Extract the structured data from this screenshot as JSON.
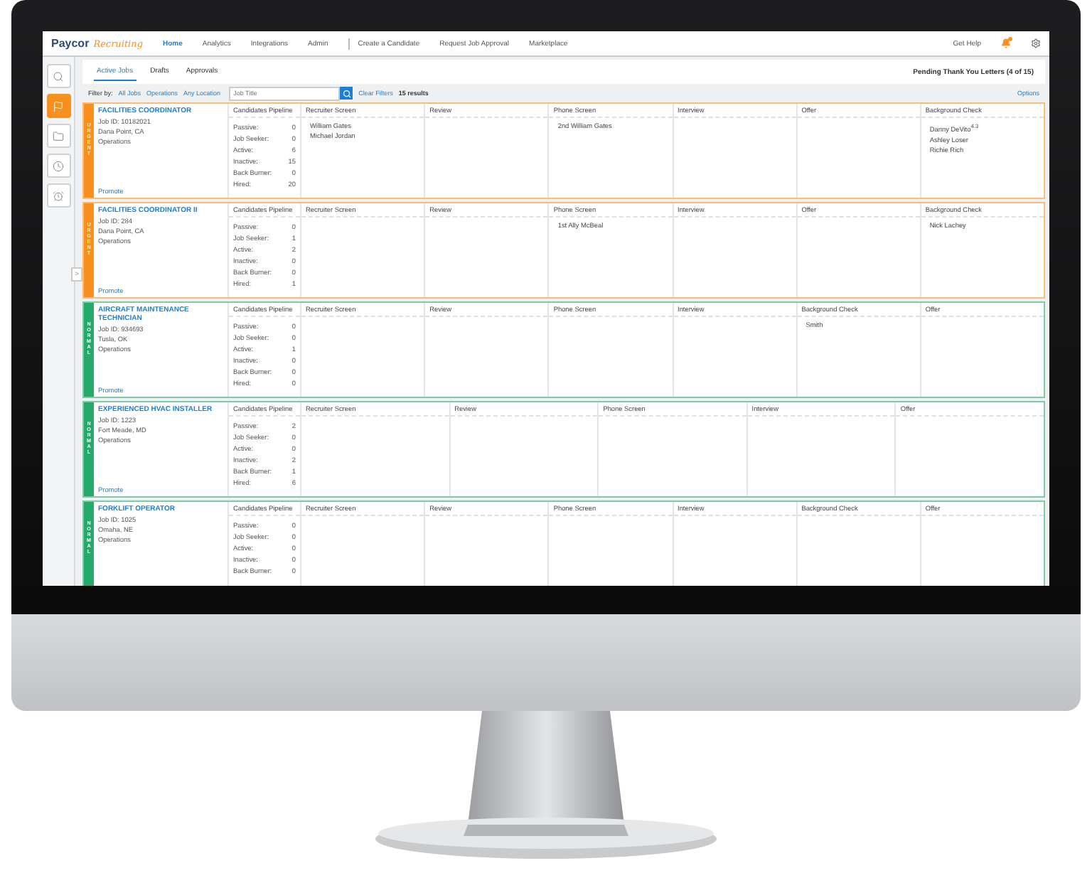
{
  "brand": {
    "name": "Paycor",
    "product": "Recruiting"
  },
  "nav": [
    {
      "label": "Home",
      "selected": true,
      "divider_before": false
    },
    {
      "label": "Analytics",
      "selected": false,
      "divider_before": false
    },
    {
      "label": "Integrations",
      "selected": false,
      "divider_before": false
    },
    {
      "label": "Admin",
      "selected": false,
      "divider_before": false
    },
    {
      "label": "Create a Candidate",
      "selected": false,
      "divider_before": true
    },
    {
      "label": "Request Job Approval",
      "selected": false,
      "divider_before": false
    },
    {
      "label": "Marketplace",
      "selected": false,
      "divider_before": false
    }
  ],
  "help": "Get Help",
  "rail": [
    {
      "selected": false
    },
    {
      "selected": true
    },
    {
      "selected": false
    },
    {
      "selected": false
    },
    {
      "selected": false
    }
  ],
  "collapse_toggle": ">",
  "tabs": [
    {
      "label": "Active Jobs",
      "selected": true
    },
    {
      "label": "Drafts",
      "selected": false
    },
    {
      "label": "Approvals",
      "selected": false
    }
  ],
  "pending": "Pending Thank You Letters (4 of 15)",
  "filter": {
    "label": "Filter by:",
    "links": [
      "All Jobs",
      "Operations",
      "Any Location"
    ],
    "placeholder": "Job Title",
    "clear": "Clear Filters",
    "results": "15 results",
    "options": "Options"
  },
  "jobs": [
    {
      "color": "#f7901e",
      "priority_label": "URGENT",
      "title": "FACILITIES COORDINATOR",
      "details": [
        "Job ID: 10182021",
        "Dana Point, CA",
        "Operations"
      ],
      "promote": "Promote",
      "pipeline_header": "Candidates Pipeline",
      "pipeline": [
        {
          "label": "Passive:",
          "value": "0"
        },
        {
          "label": "Job Seeker:",
          "value": "0"
        },
        {
          "label": "Active:",
          "value": "6"
        },
        {
          "label": "Inactive:",
          "value": "15"
        },
        {
          "label": "Back Burner:",
          "value": "0"
        },
        {
          "label": "Hired:",
          "value": "20"
        }
      ],
      "stages": [
        {
          "name": "Recruiter Screen",
          "candidates": [
            "William Gates",
            "Michael Jordan"
          ]
        },
        {
          "name": "Review"
        },
        {
          "name": "Phone Screen",
          "candidates": [
            "2nd William Gates"
          ]
        },
        {
          "name": "Interview"
        },
        {
          "name": "Offer"
        },
        {
          "name": "Background Check",
          "candidates": [
            "Danny DeVito$^{4.3}$",
            "Ashley Loser",
            "Richie Rich"
          ]
        }
      ]
    },
    {
      "color": "#f7901e",
      "priority_label": "URGENT",
      "title": "FACILITIES COORDINATOR II",
      "details": [
        "Job ID: 284",
        "Dana Point, CA",
        "Operations"
      ],
      "promote": "Promote",
      "pipeline_header": "Candidates Pipeline",
      "pipeline": [
        {
          "label": "Passive:",
          "value": "0"
        },
        {
          "label": "Job Seeker:",
          "value": "1"
        },
        {
          "label": "Active:",
          "value": "2"
        },
        {
          "label": "Inactive:",
          "value": "0"
        },
        {
          "label": "Back Burner:",
          "value": "0"
        },
        {
          "label": "Hired:",
          "value": "1"
        }
      ],
      "stages": [
        {
          "name": "Recruiter Screen"
        },
        {
          "name": "Review"
        },
        {
          "name": "Phone Screen",
          "candidates": [
            "1st Ally McBeal"
          ]
        },
        {
          "name": "Interview"
        },
        {
          "name": "Offer"
        },
        {
          "name": "Background Check",
          "candidates": [
            "Nick Lachey"
          ]
        }
      ]
    },
    {
      "color": "#27a86b",
      "priority_label": "NORMAL",
      "title": "AIRCRAFT MAINTENANCE TECHNICIAN",
      "details": [
        "Job ID: 934693",
        "Tusla, OK",
        "Operations"
      ],
      "promote": "Promote",
      "pipeline_header": "Candidates Pipeline",
      "pipeline": [
        {
          "label": "Passive:",
          "value": "0"
        },
        {
          "label": "Job Seeker:",
          "value": "0"
        },
        {
          "label": "Active:",
          "value": "1"
        },
        {
          "label": "Inactive:",
          "value": "0"
        },
        {
          "label": "Back Burner:",
          "value": "0"
        },
        {
          "label": "Hired:",
          "value": "0"
        }
      ],
      "stages": [
        {
          "name": "Recruiter Screen"
        },
        {
          "name": "Review"
        },
        {
          "name": "Phone Screen"
        },
        {
          "name": "Interview"
        },
        {
          "name": "Background Check",
          "candidates": [
            "Smith"
          ]
        },
        {
          "name": "Offer"
        }
      ]
    },
    {
      "color": "#27a86b",
      "priority_label": "NORMAL",
      "title": "EXPERIENCED HVAC INSTALLER",
      "details": [
        "Job ID: 1223",
        "Fort Meade, MD",
        "Operations"
      ],
      "promote": "Promote",
      "pipeline_header": "Candidates Pipeline",
      "pipeline": [
        {
          "label": "Passive:",
          "value": "2"
        },
        {
          "label": "Job Seeker:",
          "value": "0"
        },
        {
          "label": "Active:",
          "value": "0"
        },
        {
          "label": "Inactive:",
          "value": "2"
        },
        {
          "label": "Back Burner:",
          "value": "1"
        },
        {
          "label": "Hired:",
          "value": "6"
        }
      ],
      "stages": [
        {
          "name": "Recruiter Screen"
        },
        {
          "name": "Review"
        },
        {
          "name": "Phone Screen"
        },
        {
          "name": "Interview"
        },
        {
          "name": "Offer"
        }
      ]
    },
    {
      "color": "#27a86b",
      "priority_label": "NORMAL",
      "title": "FORKLIFT OPERATOR",
      "details": [
        "Job ID: 1025",
        "Omaha, NE",
        "Operations"
      ],
      "pipeline_header": "Candidates Pipeline",
      "pipeline": [
        {
          "label": "Passive:",
          "value": "0"
        },
        {
          "label": "Job Seeker:",
          "value": "0"
        },
        {
          "label": "Active:",
          "value": "0"
        },
        {
          "label": "Inactive:",
          "value": "0"
        },
        {
          "label": "Back Burner:",
          "value": "0"
        }
      ],
      "stages": [
        {
          "name": "Recruiter Screen"
        },
        {
          "name": "Review"
        },
        {
          "name": "Phone Screen"
        },
        {
          "name": "Interview"
        },
        {
          "name": "Background Check"
        },
        {
          "name": "Offer"
        }
      ]
    }
  ]
}
